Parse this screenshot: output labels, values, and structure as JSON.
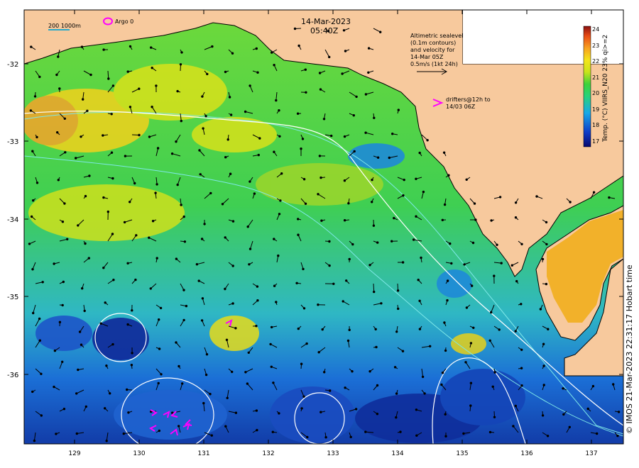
{
  "map": {
    "date": "14-Mar-2023",
    "time": "05:40Z",
    "colors": {
      "land": "#f7c99d",
      "shelf_contour": "#7ee8e8",
      "altimetry_contour": "#ffffff",
      "drifter": "#ff00ff",
      "vectors": "#000000"
    },
    "scale_bar": "200  1000m",
    "argo_label": "Argo 0",
    "altimetry_note": [
      "Altimetric sealevel",
      "(0.1m contours)",
      "and velocity for",
      "14-Mar 05Z",
      "0.5m/s (1kt 24h)"
    ],
    "drifter_note": [
      "drifters@12h to",
      "14/03 06Z"
    ],
    "lat_ticks": [
      "-32",
      "-33",
      "-34",
      "-35",
      "-36"
    ],
    "lon_ticks": [
      "129",
      "130",
      "131",
      "132",
      "133",
      "134",
      "135",
      "136",
      "137"
    ],
    "credit": "© IMOS 21-Mar-2023 22:31:17 Hobart time"
  },
  "colorbar": {
    "title": "Temp. (°C) VIIRS_N20 23% qi>=2",
    "ticks": [
      "24",
      "23",
      "22",
      "21",
      "20",
      "19",
      "18",
      "17"
    ],
    "range": [
      16.5,
      24
    ]
  }
}
